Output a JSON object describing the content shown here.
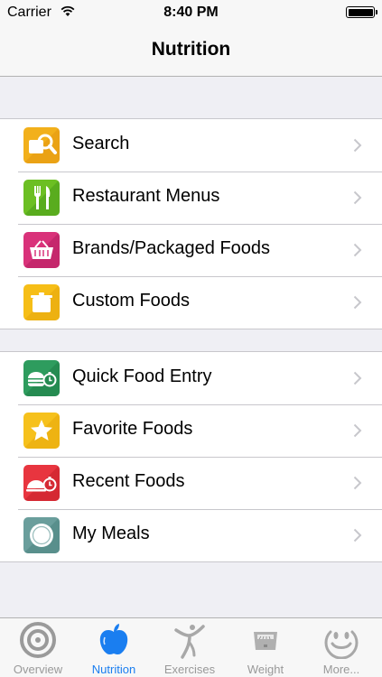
{
  "status_bar": {
    "carrier": "Carrier",
    "time": "8:40 PM"
  },
  "nav": {
    "title": "Nutrition"
  },
  "groups": [
    {
      "items": [
        {
          "label": "Search",
          "icon": "search-food-icon",
          "color": "#f2b01b"
        },
        {
          "label": "Restaurant Menus",
          "icon": "fork-knife-icon",
          "color": "#6cbf23"
        },
        {
          "label": "Brands/Packaged Foods",
          "icon": "basket-icon",
          "color": "#d9327a"
        },
        {
          "label": "Custom Foods",
          "icon": "pot-icon",
          "color": "#f6be17"
        }
      ]
    },
    {
      "items": [
        {
          "label": "Quick Food Entry",
          "icon": "burger-timer-icon",
          "color": "#2e9c5e"
        },
        {
          "label": "Favorite Foods",
          "icon": "star-icon",
          "color": "#f6c11c"
        },
        {
          "label": "Recent Foods",
          "icon": "dish-timer-icon",
          "color": "#e8353f"
        },
        {
          "label": "My Meals",
          "icon": "plate-icon",
          "color": "#6a9e9c"
        }
      ]
    }
  ],
  "tabs": [
    {
      "label": "Overview",
      "icon": "overview-icon",
      "active": false
    },
    {
      "label": "Nutrition",
      "icon": "apple-icon",
      "active": true
    },
    {
      "label": "Exercises",
      "icon": "exercise-figure-icon",
      "active": false
    },
    {
      "label": "Weight",
      "icon": "scale-icon",
      "active": false
    },
    {
      "label": "More...",
      "icon": "smiley-icon",
      "active": false
    }
  ],
  "colors": {
    "accent": "#1a7ef0",
    "inactive": "#999999",
    "background": "#efeff4"
  }
}
